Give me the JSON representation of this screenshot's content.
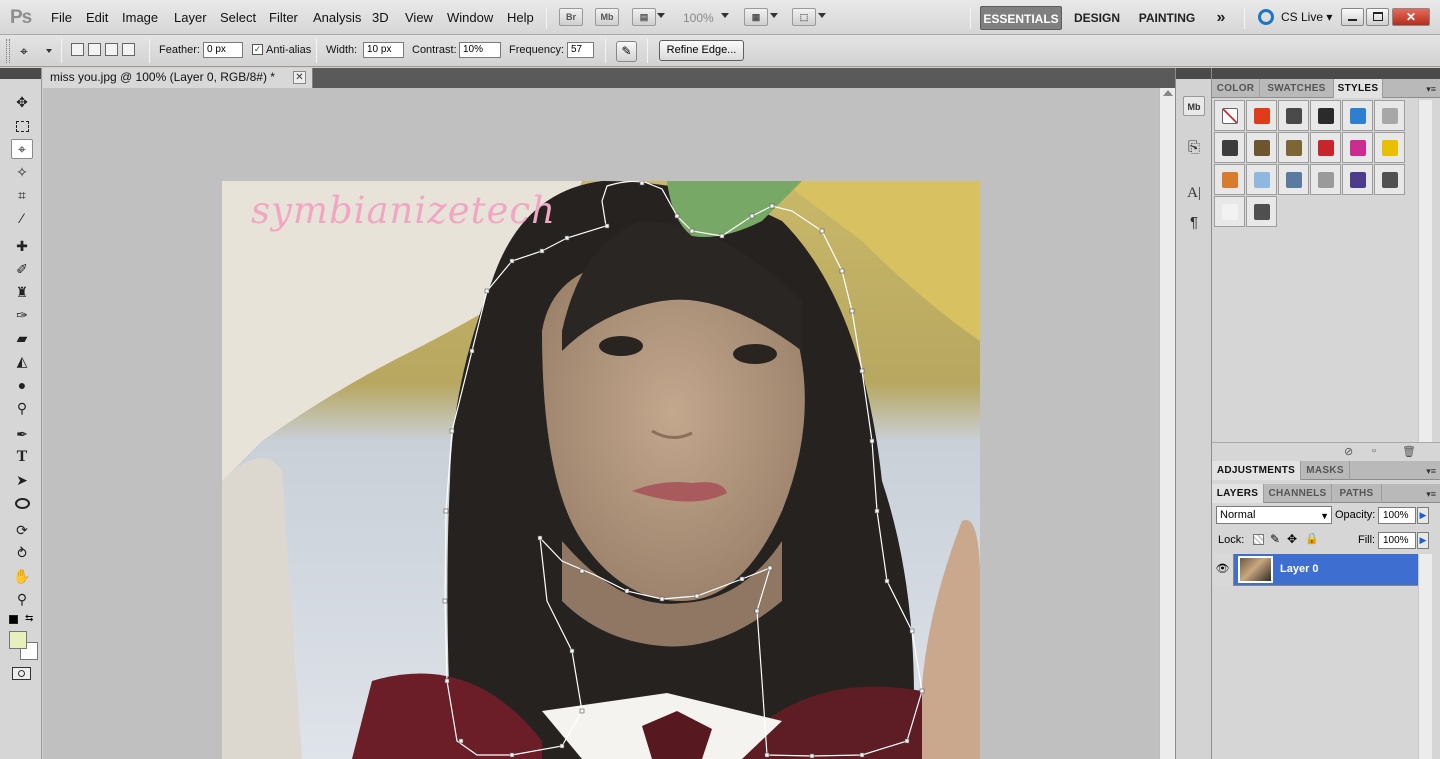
{
  "app": {
    "logo": "Ps",
    "menu": [
      "File",
      "Edit",
      "Image",
      "Layer",
      "Select",
      "Filter",
      "Analysis",
      "3D",
      "View",
      "Window",
      "Help"
    ],
    "app_buttons": [
      "Br",
      "Mb"
    ],
    "zoom": "100%",
    "workspaces": [
      "ESSENTIALS",
      "DESIGN",
      "PAINTING"
    ],
    "more_workspaces": "»",
    "cs_live": "CS Live"
  },
  "options": {
    "feather_label": "Feather:",
    "feather_value": "0 px",
    "antialias_label": "Anti-alias",
    "antialias_checked": true,
    "width_label": "Width:",
    "width_value": "10 px",
    "contrast_label": "Contrast:",
    "contrast_value": "10%",
    "frequency_label": "Frequency:",
    "frequency_value": "57",
    "refine_edge": "Refine Edge..."
  },
  "document": {
    "tab_title": "miss you.jpg @ 100% (Layer 0, RGB/8#) *",
    "close_glyph": "✕",
    "watermark": "symbianizetech"
  },
  "toolbox": {
    "foreground_color": "#e6efbe",
    "background_color": "#ffffff",
    "active_tool": "magnetic-lasso-tool"
  },
  "panels": {
    "top_tabs": [
      "COLOR",
      "SWATCHES",
      "STYLES"
    ],
    "top_active": "STYLES",
    "styles": [
      "#ffffff",
      "#e13c1a",
      "#4a4a4a",
      "#2b2b2b",
      "#2c7fd1",
      "#a7a7a7",
      "#3c3c3c",
      "#6d5530",
      "#7d6535",
      "#c8242b",
      "#cc2c8f",
      "#e8c000",
      "#d97b2c",
      "#8fb8e0",
      "#5a7aa0",
      "#9a9a9a",
      "#4d3c8c",
      "#505050",
      "#f2f2f2",
      "#4f4f4f"
    ],
    "mid_tabs": [
      "ADJUSTMENTS",
      "MASKS"
    ],
    "mid_active": "ADJUSTMENTS",
    "layer_tabs": [
      "LAYERS",
      "CHANNELS",
      "PATHS"
    ],
    "layer_active": "LAYERS",
    "blend_mode": "Normal",
    "opacity_label": "Opacity:",
    "opacity_value": "100%",
    "lock_label": "Lock:",
    "fill_label": "Fill:",
    "fill_value": "100%",
    "layer_name": "Layer 0"
  }
}
